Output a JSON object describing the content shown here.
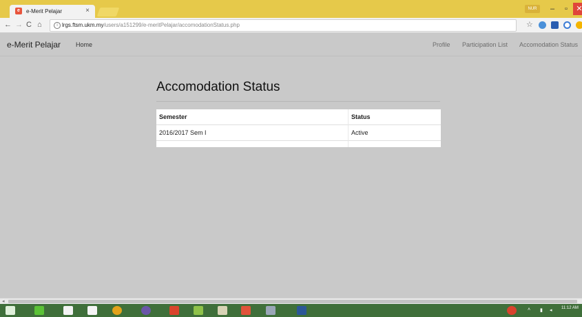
{
  "browser": {
    "tab_title": "e-Merit Pelajar",
    "tab_close": "×",
    "favicon_text": "e",
    "user_badge": "NUR",
    "window_controls": {
      "minimize": "–",
      "maximize": "▫",
      "close": "✕"
    },
    "nav_icons": {
      "back": "←",
      "forward": "→",
      "reload": "C",
      "home": "⌂",
      "info": "i",
      "star": "☆"
    },
    "url_host": "lrgs.ftsm.ukm.my",
    "url_path": "/users/a151299/e-meritPelajar/accomodationStatus.php"
  },
  "navbar": {
    "brand": "e-Merit Pelajar",
    "home": "Home",
    "links": [
      "Profile",
      "Participation List",
      "Accomodation Status"
    ]
  },
  "main": {
    "title": "Accomodation Status",
    "table": {
      "headers": [
        "Semester",
        "Status"
      ],
      "rows": [
        [
          "2016/2017 Sem I",
          "Active"
        ]
      ]
    }
  },
  "scrollbar": {
    "left_arrow": "◂"
  },
  "taskbar": {
    "clock": "11:12 AM"
  },
  "colors": {
    "titlebar": "#e6c94a",
    "page_background": "#c9c9c9",
    "taskbar": "#3f6f3a",
    "close_button": "#e0453a"
  }
}
